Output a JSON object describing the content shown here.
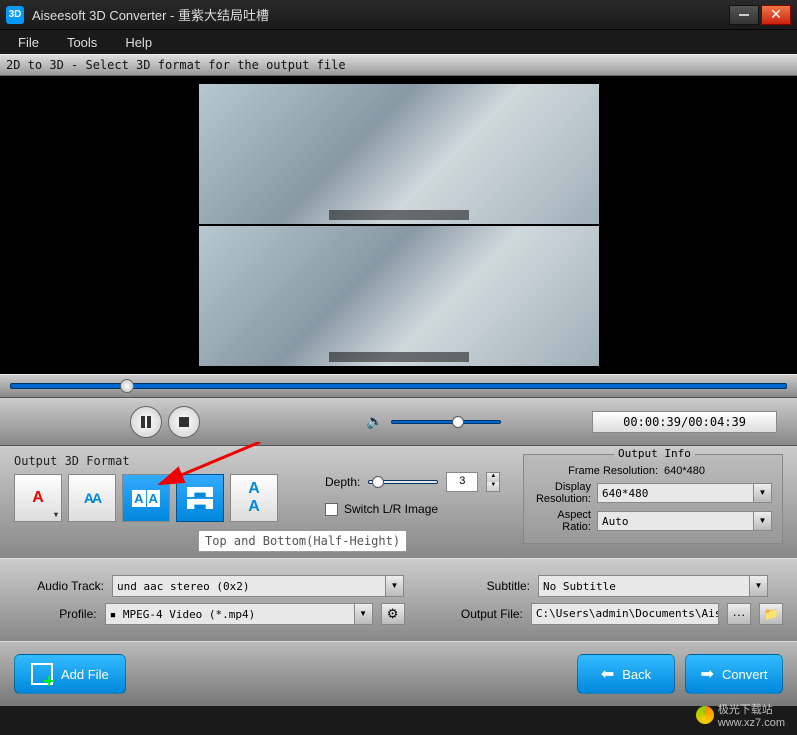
{
  "titlebar": {
    "app_name": "Aiseesoft 3D Converter",
    "document": "重紫大结局吐槽"
  },
  "menu": {
    "file": "File",
    "tools": "Tools",
    "help": "Help"
  },
  "status": "2D to 3D - Select 3D format for the output file",
  "timeline": {
    "position_pct": 14
  },
  "playback": {
    "volume_pct": 55,
    "time": "00:00:39/00:04:39"
  },
  "output_format": {
    "label": "Output 3D Format",
    "buttons": [
      "Anaglyph",
      "Side by Side (Half-Width)",
      "Side by Side (Full)",
      "Top and Bottom (Half-Height)",
      "Top and Bottom (Full)"
    ],
    "selected_index": 3,
    "tooltip": "Top and Bottom(Half-Height)"
  },
  "depth": {
    "label": "Depth:",
    "value": "3",
    "switch_label": "Switch L/R Image",
    "switch_checked": false
  },
  "output_info": {
    "legend": "Output Info",
    "frame_res_label": "Frame Resolution:",
    "frame_res": "640*480",
    "display_res_label": "Display Resolution:",
    "display_res": "640*480",
    "aspect_label": "Aspect Ratio:",
    "aspect": "Auto"
  },
  "options": {
    "audio_label": "Audio Track:",
    "audio_value": "und aac stereo (0x2)",
    "subtitle_label": "Subtitle:",
    "subtitle_value": "No Subtitle",
    "profile_label": "Profile:",
    "profile_value": "MPEG-4 Video (*.mp4)",
    "output_file_label": "Output File:",
    "output_file_value": "C:\\Users\\admin\\Documents\\Aiseesoft St"
  },
  "actions": {
    "add_file": "Add File",
    "back": "Back",
    "convert": "Convert"
  },
  "watermark": {
    "name": "极光下载站",
    "url": "www.xz7.com"
  }
}
